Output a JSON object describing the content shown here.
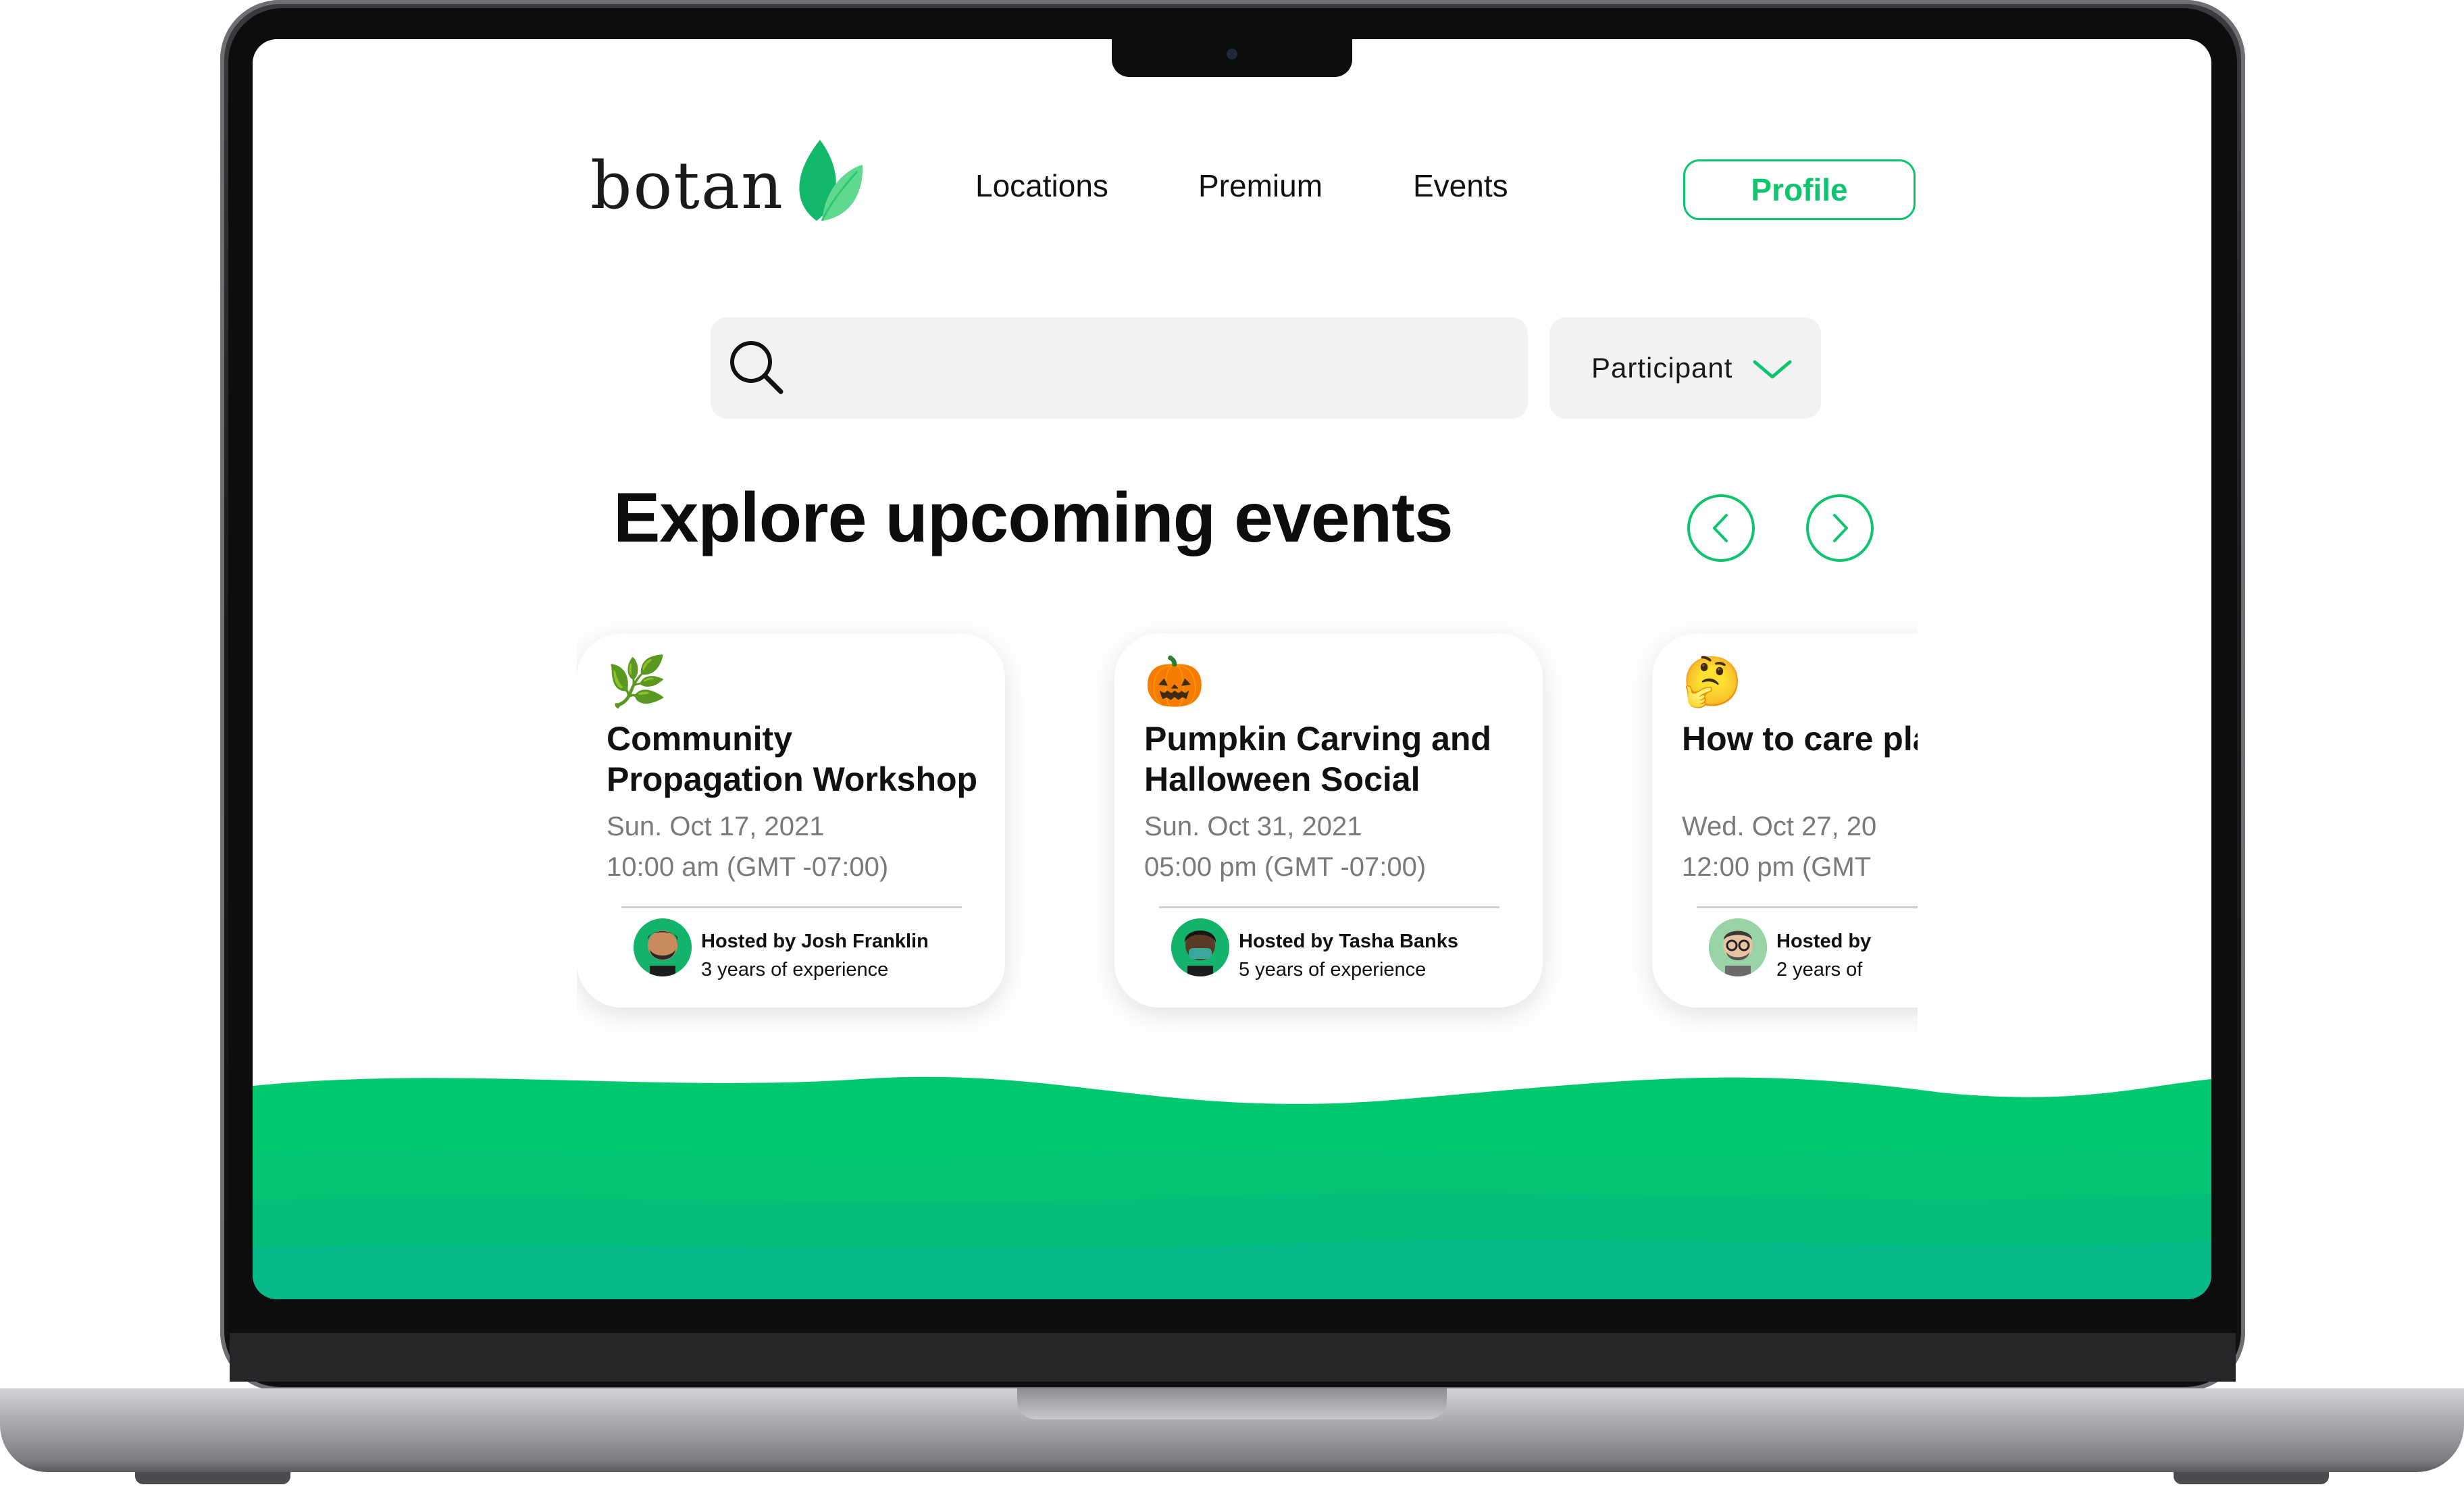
{
  "brand": {
    "name": "botan",
    "leaf_color": "#14b86a",
    "leaf_light": "#5fd98e"
  },
  "nav": {
    "locations": "Locations",
    "premium": "Premium",
    "events": "Events"
  },
  "profile_button": "Profile",
  "search": {
    "placeholder": "",
    "icon": "search-icon"
  },
  "role_select": {
    "selected": "Participant",
    "icon": "chevron-down-icon"
  },
  "section": {
    "heading": "Explore upcoming events"
  },
  "carousel_controls": {
    "prev_icon": "chevron-left-icon",
    "next_icon": "chevron-right-icon"
  },
  "events": [
    {
      "emoji": "🌿",
      "title": "Community Propagation Workshop",
      "date": "Sun. Oct 17, 2021",
      "time": "10:00 am (GMT -07:00)",
      "host": "Hosted by Josh Franklin",
      "experience": "3 years of experience"
    },
    {
      "emoji": "🎃",
      "title": "Pumpkin Carving and Halloween Social",
      "date": "Sun. Oct 31, 2021",
      "time": "05:00 pm (GMT -07:00)",
      "host": "Hosted by Tasha Banks",
      "experience": "5 years of experience"
    },
    {
      "emoji": "🤔",
      "title": "How to care plants",
      "date": "Wed. Oct 27, 20",
      "time": "12:00 pm (GMT",
      "host": "Hosted by",
      "experience": "2 years of"
    }
  ],
  "colors": {
    "accent": "#0fc46e",
    "wave": "#00c86f",
    "wave_dark": "#06b88a"
  }
}
